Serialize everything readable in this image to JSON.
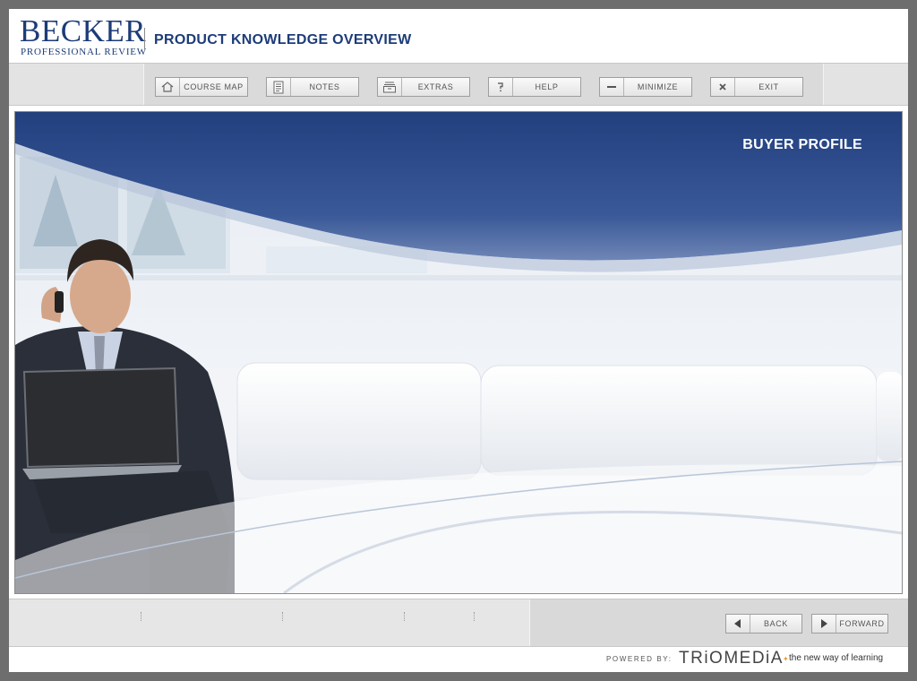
{
  "header": {
    "logo_main": "BECKER",
    "logo_sub": "PROFESSIONAL REVIEW",
    "course_title": "PRODUCT KNOWLEDGE OVERVIEW"
  },
  "toolbar": {
    "buttons": [
      {
        "label": "COURSE MAP",
        "icon": "home-icon"
      },
      {
        "label": "NOTES",
        "icon": "notes-icon"
      },
      {
        "label": "EXTRAS",
        "icon": "extras-icon"
      },
      {
        "label": "HELP",
        "icon": "help-icon"
      },
      {
        "label": "MINIMIZE",
        "icon": "minimize-icon"
      },
      {
        "label": "EXIT",
        "icon": "close-icon"
      }
    ]
  },
  "slide": {
    "title": "BUYER PROFILE",
    "image": "businessman-on-phone-with-laptop-on-sofa"
  },
  "nav": {
    "back_label": "BACK",
    "forward_label": "FORWARD"
  },
  "footer": {
    "powered_label": "POWERED BY:",
    "brand": "TRiOMEDiA",
    "tagline": "the new way of learning"
  },
  "colors": {
    "brand_blue": "#1d3c78",
    "banner_blue": "#2e4c8c",
    "frame_gray": "#6e6e6e",
    "accent_orange": "#e59a2b"
  }
}
